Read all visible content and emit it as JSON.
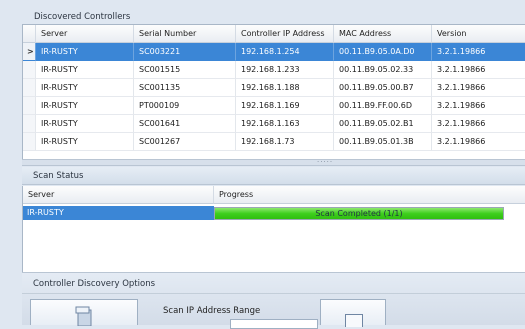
{
  "discovered": {
    "title": "Discovered Controllers",
    "columns": [
      "Server",
      "Serial Number",
      "Controller IP Address",
      "MAC Address",
      "Version"
    ],
    "rows": [
      {
        "server": "IR-RUSTY",
        "serial": "SC003221",
        "ip": "192.168.1.254",
        "mac": "00.11.B9.05.0A.D0",
        "version": "3.2.1.19866",
        "selected": true
      },
      {
        "server": "IR-RUSTY",
        "serial": "SC001515",
        "ip": "192.168.1.233",
        "mac": "00.11.B9.05.02.33",
        "version": "3.2.1.19866",
        "selected": false
      },
      {
        "server": "IR-RUSTY",
        "serial": "SC001135",
        "ip": "192.168.1.188",
        "mac": "00.11.B9.05.00.B7",
        "version": "3.2.1.19866",
        "selected": false
      },
      {
        "server": "IR-RUSTY",
        "serial": "PT000109",
        "ip": "192.168.1.169",
        "mac": "00.11.B9.FF.00.6D",
        "version": "3.2.1.19866",
        "selected": false
      },
      {
        "server": "IR-RUSTY",
        "serial": "SC001641",
        "ip": "192.168.1.163",
        "mac": "00.11.B9.05.02.B1",
        "version": "3.2.1.19866",
        "selected": false
      },
      {
        "server": "IR-RUSTY",
        "serial": "SC001267",
        "ip": "192.168.1.73",
        "mac": "00.11.B9.05.01.3B",
        "version": "3.2.1.19866",
        "selected": false
      }
    ],
    "selected_marker": ">"
  },
  "scan_status": {
    "title": "Scan Status",
    "columns": [
      "Server",
      "Progress"
    ],
    "rows": [
      {
        "server": "IR-RUSTY",
        "progress_text": "Scan Completed (1/1)",
        "progress_fraction": 1.0
      }
    ]
  },
  "options": {
    "title": "Controller Discovery Options",
    "scan_range_label": "Scan IP Address Range"
  },
  "colors": {
    "selection": "#3b86d6",
    "progress": "#3fcf1e"
  }
}
